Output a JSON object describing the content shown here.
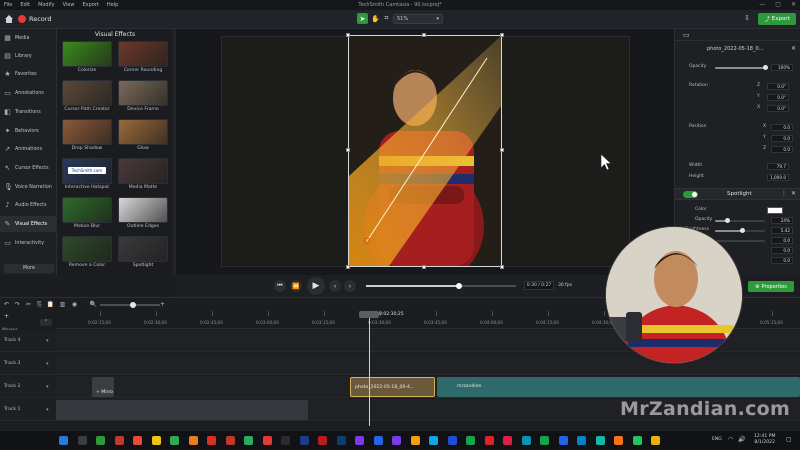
{
  "menu": [
    "File",
    "Edit",
    "Modify",
    "View",
    "Export",
    "Help"
  ],
  "window_title": "TechSmith Camtasia - 90.tscproj*",
  "window_controls": [
    "—",
    "▢",
    "✕"
  ],
  "toolbar": {
    "record_label": "Record",
    "zoom": "51%",
    "export_label": "Export"
  },
  "sidebar": {
    "items": [
      {
        "label": "Media",
        "icon": "film-icon"
      },
      {
        "label": "Library",
        "icon": "library-icon"
      },
      {
        "label": "Favorites",
        "icon": "star-icon"
      },
      {
        "label": "Annotations",
        "icon": "annotation-icon"
      },
      {
        "label": "Transitions",
        "icon": "transition-icon"
      },
      {
        "label": "Behaviors",
        "icon": "behavior-icon"
      },
      {
        "label": "Animations",
        "icon": "animation-icon"
      },
      {
        "label": "Cursor Effects",
        "icon": "cursor-icon"
      },
      {
        "label": "Voice Narration",
        "icon": "mic-icon"
      },
      {
        "label": "Audio Effects",
        "icon": "audio-icon"
      },
      {
        "label": "Visual Effects",
        "icon": "visual-effects-icon"
      },
      {
        "label": "Interactivity",
        "icon": "interactivity-icon"
      }
    ],
    "more_label": "More",
    "active_index": 10
  },
  "fx_panel": {
    "title": "Visual Effects",
    "items": [
      {
        "label": "Colorize",
        "color": "#3d8a1e"
      },
      {
        "label": "Corner Rounding",
        "color": "#6a3a2a"
      },
      {
        "label": "Cursor Path Creator",
        "color": "#5a4a3a"
      },
      {
        "label": "Device Frame",
        "color": "#7a6a5a"
      },
      {
        "label": "Drop Shadow",
        "color": "#8a5a3a"
      },
      {
        "label": "Glow",
        "color": "#9a6a3a"
      },
      {
        "label": "Interactive Hotspot",
        "color": "#2a3a5a",
        "overlay": "TechSmith.com"
      },
      {
        "label": "Media Matte",
        "color": "#4a3a3a"
      },
      {
        "label": "Motion Blur",
        "color": "#2e6a2a"
      },
      {
        "label": "Outline Edges",
        "color": "#d8d8d8"
      },
      {
        "label": "Remove a Color",
        "color": "#2e4a2a"
      },
      {
        "label": "Spotlight",
        "color": "#3a3a3a"
      }
    ]
  },
  "properties": {
    "clip_title": "photo_2022-05-18_0...",
    "opacity": {
      "label": "Opacity",
      "value": "100%",
      "fraction": 1.0
    },
    "rotation": {
      "label": "Rotation",
      "z": "0.0°",
      "y": "0.0°",
      "x": "0.0°",
      "z_label": "Z",
      "y_label": "Y",
      "x_label": "X"
    },
    "position": {
      "label": "Position",
      "x": "0.0",
      "y": "0.0",
      "z": "0.0",
      "x_label": "X",
      "y_label": "Y",
      "z_label": "Z"
    },
    "width": {
      "label": "Width",
      "value": "79.7"
    },
    "height": {
      "label": "Height",
      "value": "1,000.0"
    },
    "spotlight": {
      "title": "Spotlight",
      "color_label": "Color",
      "opacity": {
        "label": "Opacity",
        "value": "24%",
        "fraction": 0.24
      },
      "brightness": {
        "label": "Brightness",
        "value": "5.42",
        "fraction": 0.54
      },
      "param4_value": "0.0",
      "param5_value": "0.0",
      "param6_value": "0.0"
    },
    "properties_button": "Properties"
  },
  "playback": {
    "time": "0:30 / 0:27",
    "fps": "30 fps",
    "progress": 0.62
  },
  "timeline": {
    "playhead_time": "0:02:30;25",
    "marker_label": "Marker",
    "ticks": [
      "0:02:15;00",
      "0:02:30;00",
      "0:02:45;00",
      "0:03:00;00",
      "0:03:15;00",
      "0:03:30;00",
      "0:03:45;00",
      "0:04:00;00",
      "0:04:15;00",
      "0:04:30;00",
      "0:04:45;00",
      "0:05:00;00",
      "0:05:15;00"
    ],
    "tracks": [
      {
        "name": "Track 4"
      },
      {
        "name": "Track 3"
      },
      {
        "name": "Track 2"
      },
      {
        "name": "Track 1"
      }
    ],
    "clips": [
      {
        "label": "+ Mirro",
        "track": 2
      },
      {
        "label": "photo_2022-05-18_00-4...",
        "track": 2
      },
      {
        "label": "mrzandien",
        "track": 2
      },
      {
        "label": "",
        "track": 3
      }
    ]
  },
  "taskbar": {
    "time": "12:41 PM",
    "date": "8/1/2022",
    "lang": "ENG"
  },
  "watermark": "MrZandian.com"
}
